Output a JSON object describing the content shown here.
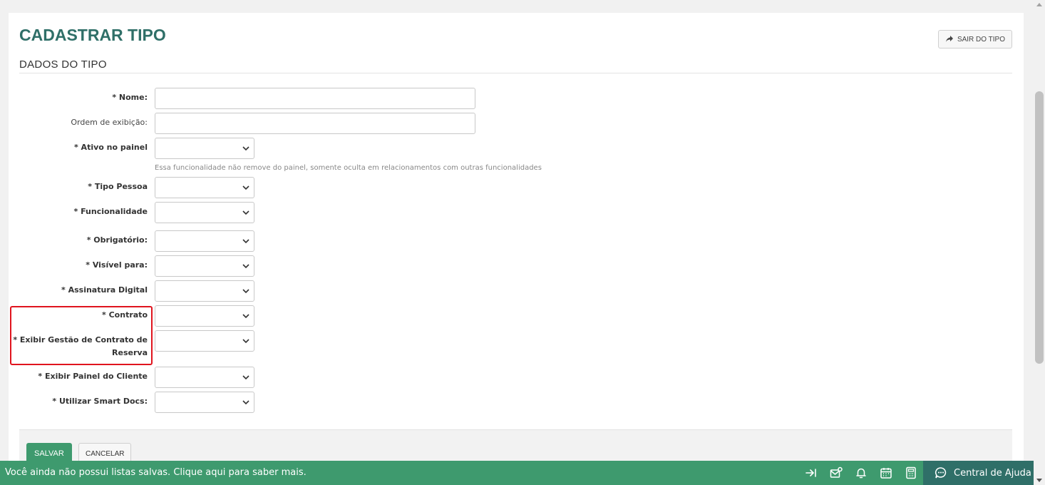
{
  "header": {
    "title": "CADASTRAR TIPO",
    "exit_label": "SAIR DO TIPO",
    "section_title": "DADOS DO TIPO"
  },
  "form": {
    "nome_label": "* Nome:",
    "ordem_label": "Ordem de exibição:",
    "ativo_label": "* Ativo no painel",
    "ativo_hint": "Essa funcionalidade não remove do painel, somente oculta em relacionamentos com outras funcionalidades",
    "tipo_pessoa_label": "* Tipo Pessoa",
    "funcionalidade_label": "* Funcionalidade",
    "obrigatorio_label": "* Obrigatório:",
    "visivel_label": "* Visível para:",
    "assinatura_label": "* Assinatura Digital",
    "contrato_label": "* Contrato",
    "gestao_label_1": "* Exibir Gestão de Contrato de",
    "gestao_label_2": "Reserva",
    "painel_cliente_label": "* Exibir Painel do Cliente",
    "smart_docs_label": "* Utilizar Smart Docs:"
  },
  "actions": {
    "save_label": "SALVAR",
    "cancel_label": "CANCELAR"
  },
  "bottom_bar": {
    "message": "Você ainda não possui listas salvas. Clique aqui para saber mais.",
    "help_label": "Central de Ajuda",
    "icons": [
      "collapse-icon",
      "mail-badge-icon",
      "bell-icon",
      "calendar-icon",
      "calculator-icon",
      "chat-icon"
    ]
  },
  "colors": {
    "accent": "#2f6f68",
    "primary_green": "#3e9a6e",
    "highlight": "#e0141e"
  }
}
